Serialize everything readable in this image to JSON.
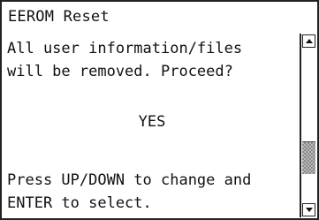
{
  "window": {
    "title": "EEROM Reset"
  },
  "message": {
    "line1": "All user information/files",
    "line2": "will be removed. Proceed?",
    "selected_option": "YES",
    "instruction_line1": "Press UP/DOWN to change and",
    "instruction_line2": "ENTER to select."
  },
  "scrollbar": {
    "up_icon": "triangle-up-icon",
    "down_icon": "triangle-down-icon",
    "position": 0.78,
    "visible_fraction": 0.22
  },
  "colors": {
    "border": "#222222",
    "text": "#111111",
    "background": "#ffffff",
    "thumb": "#b8b8b8"
  }
}
